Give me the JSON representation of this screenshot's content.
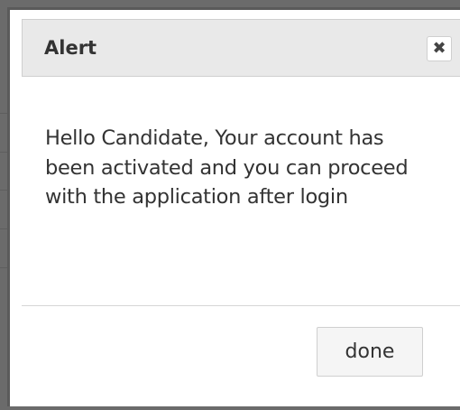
{
  "dialog": {
    "title": "Alert",
    "close_icon": "close-icon",
    "close_glyph": "✖",
    "message": "Hello Candidate, Your account has been activated and you can proceed with the application after login",
    "done_label": "done"
  },
  "colors": {
    "backdrop": "#6b6b6b",
    "header_bg": "#e9e9e9",
    "text": "#333333"
  }
}
